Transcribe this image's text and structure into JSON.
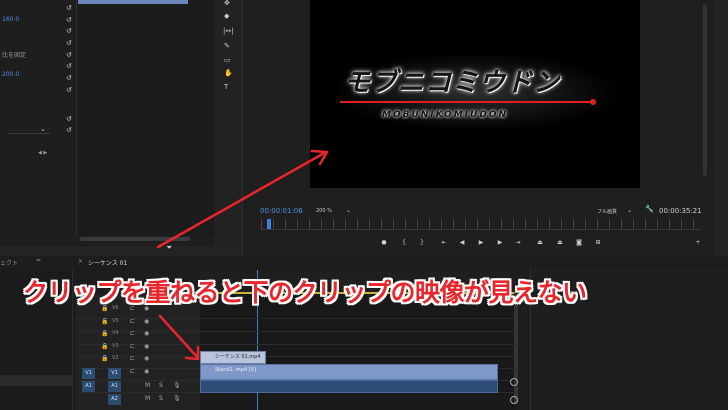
{
  "effects_panel": {
    "value_1": "160.0",
    "value_2": "比を固定",
    "value_3": "200.0",
    "nav_arrows": "◀ ▶"
  },
  "program_monitor": {
    "logo_text": "モブニコミウドン",
    "logo_subtext": "MOBUNIKOMIUDON",
    "current_time": "00:00:01:06",
    "zoom": "200 %",
    "quality": "フル画質",
    "duration": "00:00:35:21"
  },
  "timeline": {
    "tab_left": "ェクト",
    "tab_mid": "=",
    "tab_close": "×",
    "tab_sequence": "シーケンス 01",
    "tracks_video": [
      "V6",
      "V5",
      "V4",
      "V3",
      "V2",
      "V1"
    ],
    "tracks_audio": [
      "A1",
      "A2"
    ],
    "source_v1": "V1",
    "source_a1": "A1",
    "clip_top": "シーケンス 01.mp4",
    "clip_bottom": "Stand1..mp4 [V]",
    "m_label": "M",
    "s_label": "S"
  },
  "annotation": {
    "caption": "クリップを重ねると下のクリップの映像が見えない",
    "arrow_color": "#e8262b",
    "caption_color": "#e8262b"
  },
  "toolbar_icons": [
    "move-icon",
    "razor-icon",
    "slip-icon",
    "pen-icon",
    "rectangle-icon",
    "hand-icon",
    "type-icon"
  ],
  "colors": {
    "accent_blue": "#4f8fe6",
    "clip_blue": "#7f98c9",
    "playhead": "#3c7fd6"
  }
}
